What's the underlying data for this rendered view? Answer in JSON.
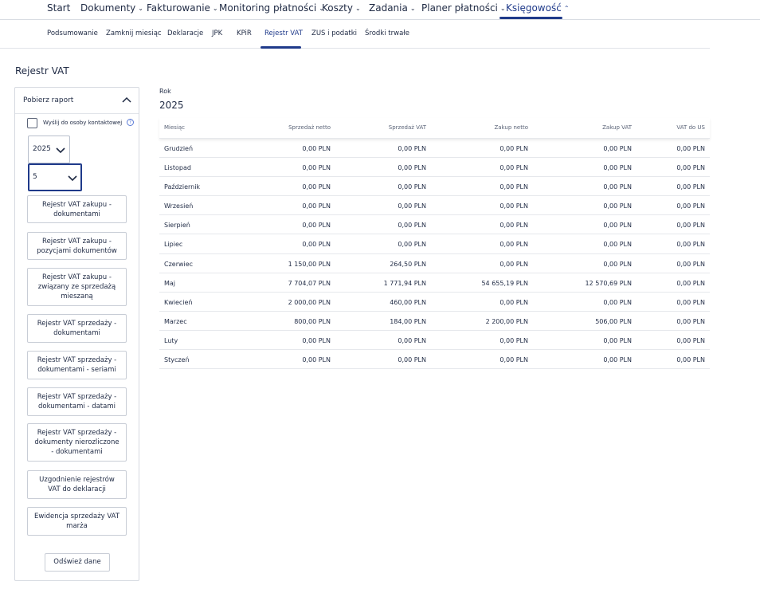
{
  "topnav": {
    "items": [
      {
        "label": "Start",
        "has_chevron": false
      },
      {
        "label": "Dokumenty",
        "has_chevron": true
      },
      {
        "label": "Fakturowanie",
        "has_chevron": true
      },
      {
        "label": "Monitoring płatności",
        "has_chevron": true
      },
      {
        "label": "Koszty",
        "has_chevron": true
      },
      {
        "label": "Zadania",
        "has_chevron": true
      },
      {
        "label": "Planer płatności",
        "has_chevron": true
      },
      {
        "label": "Księgowość",
        "has_chevron": true,
        "active": true
      }
    ],
    "chev_down": "⌄",
    "chev_up": "⌃"
  },
  "subnav": {
    "items": [
      {
        "label": "Podsumowanie"
      },
      {
        "label": "Zamknij miesiąc"
      },
      {
        "label": "Deklaracje"
      },
      {
        "label": "JPK"
      },
      {
        "label": "KPiR"
      },
      {
        "label": "Rejestr VAT",
        "active": true
      },
      {
        "label": "ZUS i podatki"
      },
      {
        "label": "Środki trwałe"
      }
    ]
  },
  "page": {
    "title": "Rejestr VAT"
  },
  "panel": {
    "header": "Pobierz raport",
    "checkbox_label": "Wyślij do osoby kontaktowej",
    "checkbox_checked": false,
    "help_icon": "?",
    "year_value": "2025",
    "month_value": "5",
    "buttons": [
      "Rejestr VAT zakupu - dokumentami",
      "Rejestr VAT zakupu - pozycjami dokumentów",
      "Rejestr VAT zakupu - związany ze sprzedażą mieszaną",
      "Rejestr VAT sprzedaży - dokumentami",
      "Rejestr VAT sprzedaży - dokumentami - seriami",
      "Rejestr VAT sprzedaży - dokumentami - datami",
      "Rejestr VAT sprzedaży - dokumenty nierozliczone - dokumentami",
      "Uzgodnienie rejestrów VAT do deklaracji",
      "Ewidencja sprzedaży VAT marża"
    ],
    "refresh_label": "Odśwież dane"
  },
  "main": {
    "rok_label": "Rok",
    "rok_value": "2025",
    "table": {
      "headers": [
        "Miesiąc",
        "Sprzedaż netto",
        "Sprzedaż VAT",
        "Zakup netto",
        "Zakup VAT",
        "VAT do US"
      ],
      "rows": [
        [
          "Grudzień",
          "0,00 PLN",
          "0,00 PLN",
          "0,00 PLN",
          "0,00 PLN",
          "0,00 PLN"
        ],
        [
          "Listopad",
          "0,00 PLN",
          "0,00 PLN",
          "0,00 PLN",
          "0,00 PLN",
          "0,00 PLN"
        ],
        [
          "Październik",
          "0,00 PLN",
          "0,00 PLN",
          "0,00 PLN",
          "0,00 PLN",
          "0,00 PLN"
        ],
        [
          "Wrzesień",
          "0,00 PLN",
          "0,00 PLN",
          "0,00 PLN",
          "0,00 PLN",
          "0,00 PLN"
        ],
        [
          "Sierpień",
          "0,00 PLN",
          "0,00 PLN",
          "0,00 PLN",
          "0,00 PLN",
          "0,00 PLN"
        ],
        [
          "Lipiec",
          "0,00 PLN",
          "0,00 PLN",
          "0,00 PLN",
          "0,00 PLN",
          "0,00 PLN"
        ],
        [
          "Czerwiec",
          "1 150,00 PLN",
          "264,50 PLN",
          "0,00 PLN",
          "0,00 PLN",
          "0,00 PLN"
        ],
        [
          "Maj",
          "7 704,07 PLN",
          "1 771,94 PLN",
          "54 655,19 PLN",
          "12 570,69 PLN",
          "0,00 PLN"
        ],
        [
          "Kwiecień",
          "2 000,00 PLN",
          "460,00 PLN",
          "0,00 PLN",
          "0,00 PLN",
          "0,00 PLN"
        ],
        [
          "Marzec",
          "800,00 PLN",
          "184,00 PLN",
          "2 200,00 PLN",
          "506,00 PLN",
          "0,00 PLN"
        ],
        [
          "Luty",
          "0,00 PLN",
          "0,00 PLN",
          "0,00 PLN",
          "0,00 PLN",
          "0,00 PLN"
        ],
        [
          "Styczeń",
          "0,00 PLN",
          "0,00 PLN",
          "0,00 PLN",
          "0,00 PLN",
          "0,00 PLN"
        ]
      ]
    }
  },
  "colors": {
    "accent": "#1f3a8a",
    "text": "#1f2a44",
    "muted": "#5b6478",
    "border": "#d5d9e0"
  }
}
